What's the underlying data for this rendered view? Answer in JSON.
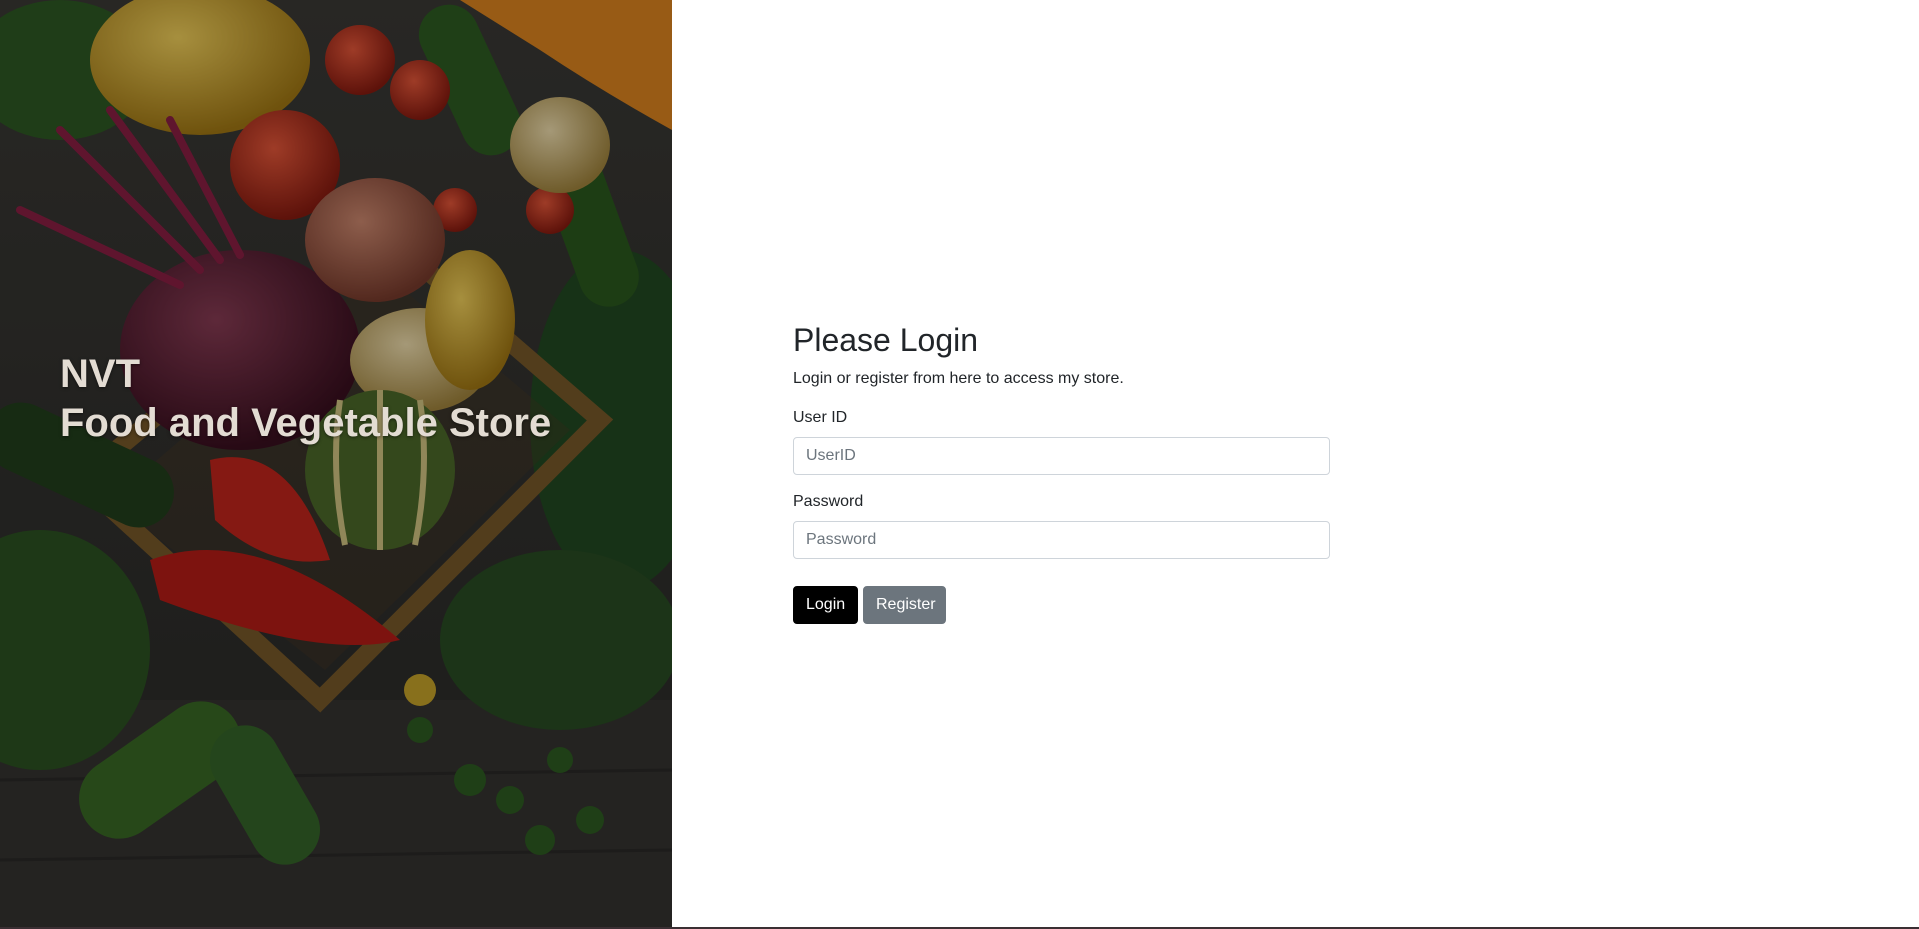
{
  "hero": {
    "brand": "NVT",
    "tagline": "Food and Vegetable Store"
  },
  "login": {
    "title": "Please Login",
    "subtitle": "Login or register from here to access my store.",
    "user_label": "User ID",
    "user_placeholder": "UserID",
    "user_value": "",
    "password_label": "Password",
    "password_placeholder": "Password",
    "password_value": "",
    "login_button": "Login",
    "register_button": "Register"
  },
  "colors": {
    "login_button": "#000000",
    "register_button": "#6c757d",
    "text": "#212529"
  }
}
